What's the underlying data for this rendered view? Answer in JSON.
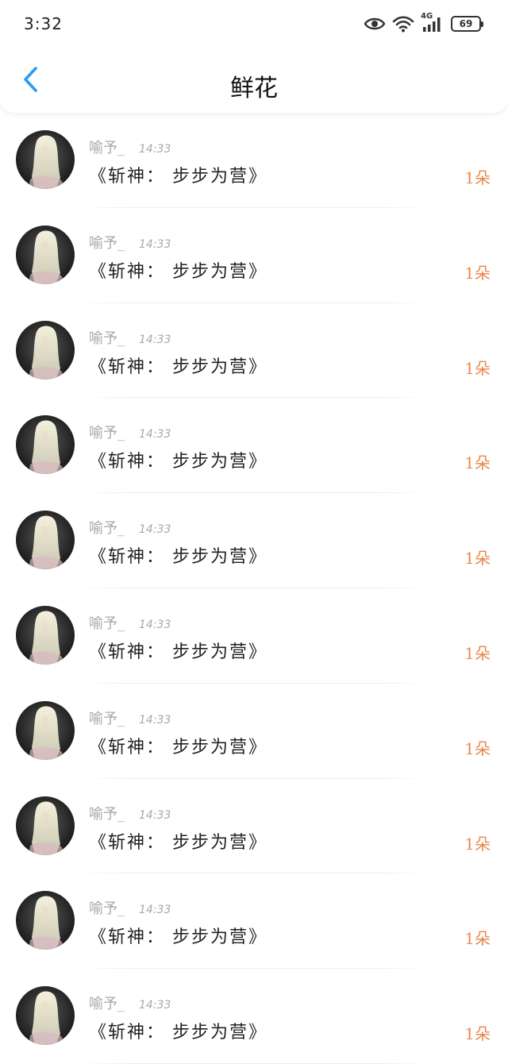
{
  "status_bar": {
    "time": "3:32",
    "network_label": "4G",
    "battery_level": "69"
  },
  "nav": {
    "title": "鲜花",
    "back_icon": "chevron-left-icon",
    "accent_color": "#2b9af3"
  },
  "colors": {
    "count": "#e8874a",
    "meta": "#a8a8a8",
    "title": "#222222"
  },
  "gifts": [
    {
      "user": "喻予_",
      "time": "14:33",
      "book": "《斩神：  步步为营》",
      "count": "1朵"
    },
    {
      "user": "喻予_",
      "time": "14:33",
      "book": "《斩神：  步步为营》",
      "count": "1朵"
    },
    {
      "user": "喻予_",
      "time": "14:33",
      "book": "《斩神：  步步为营》",
      "count": "1朵"
    },
    {
      "user": "喻予_",
      "time": "14:33",
      "book": "《斩神：  步步为营》",
      "count": "1朵"
    },
    {
      "user": "喻予_",
      "time": "14:33",
      "book": "《斩神：  步步为营》",
      "count": "1朵"
    },
    {
      "user": "喻予_",
      "time": "14:33",
      "book": "《斩神：  步步为营》",
      "count": "1朵"
    },
    {
      "user": "喻予_",
      "time": "14:33",
      "book": "《斩神：  步步为营》",
      "count": "1朵"
    },
    {
      "user": "喻予_",
      "time": "14:33",
      "book": "《斩神：  步步为营》",
      "count": "1朵"
    },
    {
      "user": "喻予_",
      "time": "14:33",
      "book": "《斩神：  步步为营》",
      "count": "1朵"
    },
    {
      "user": "喻予_",
      "time": "14:33",
      "book": "《斩神：  步步为营》",
      "count": "1朵"
    }
  ]
}
